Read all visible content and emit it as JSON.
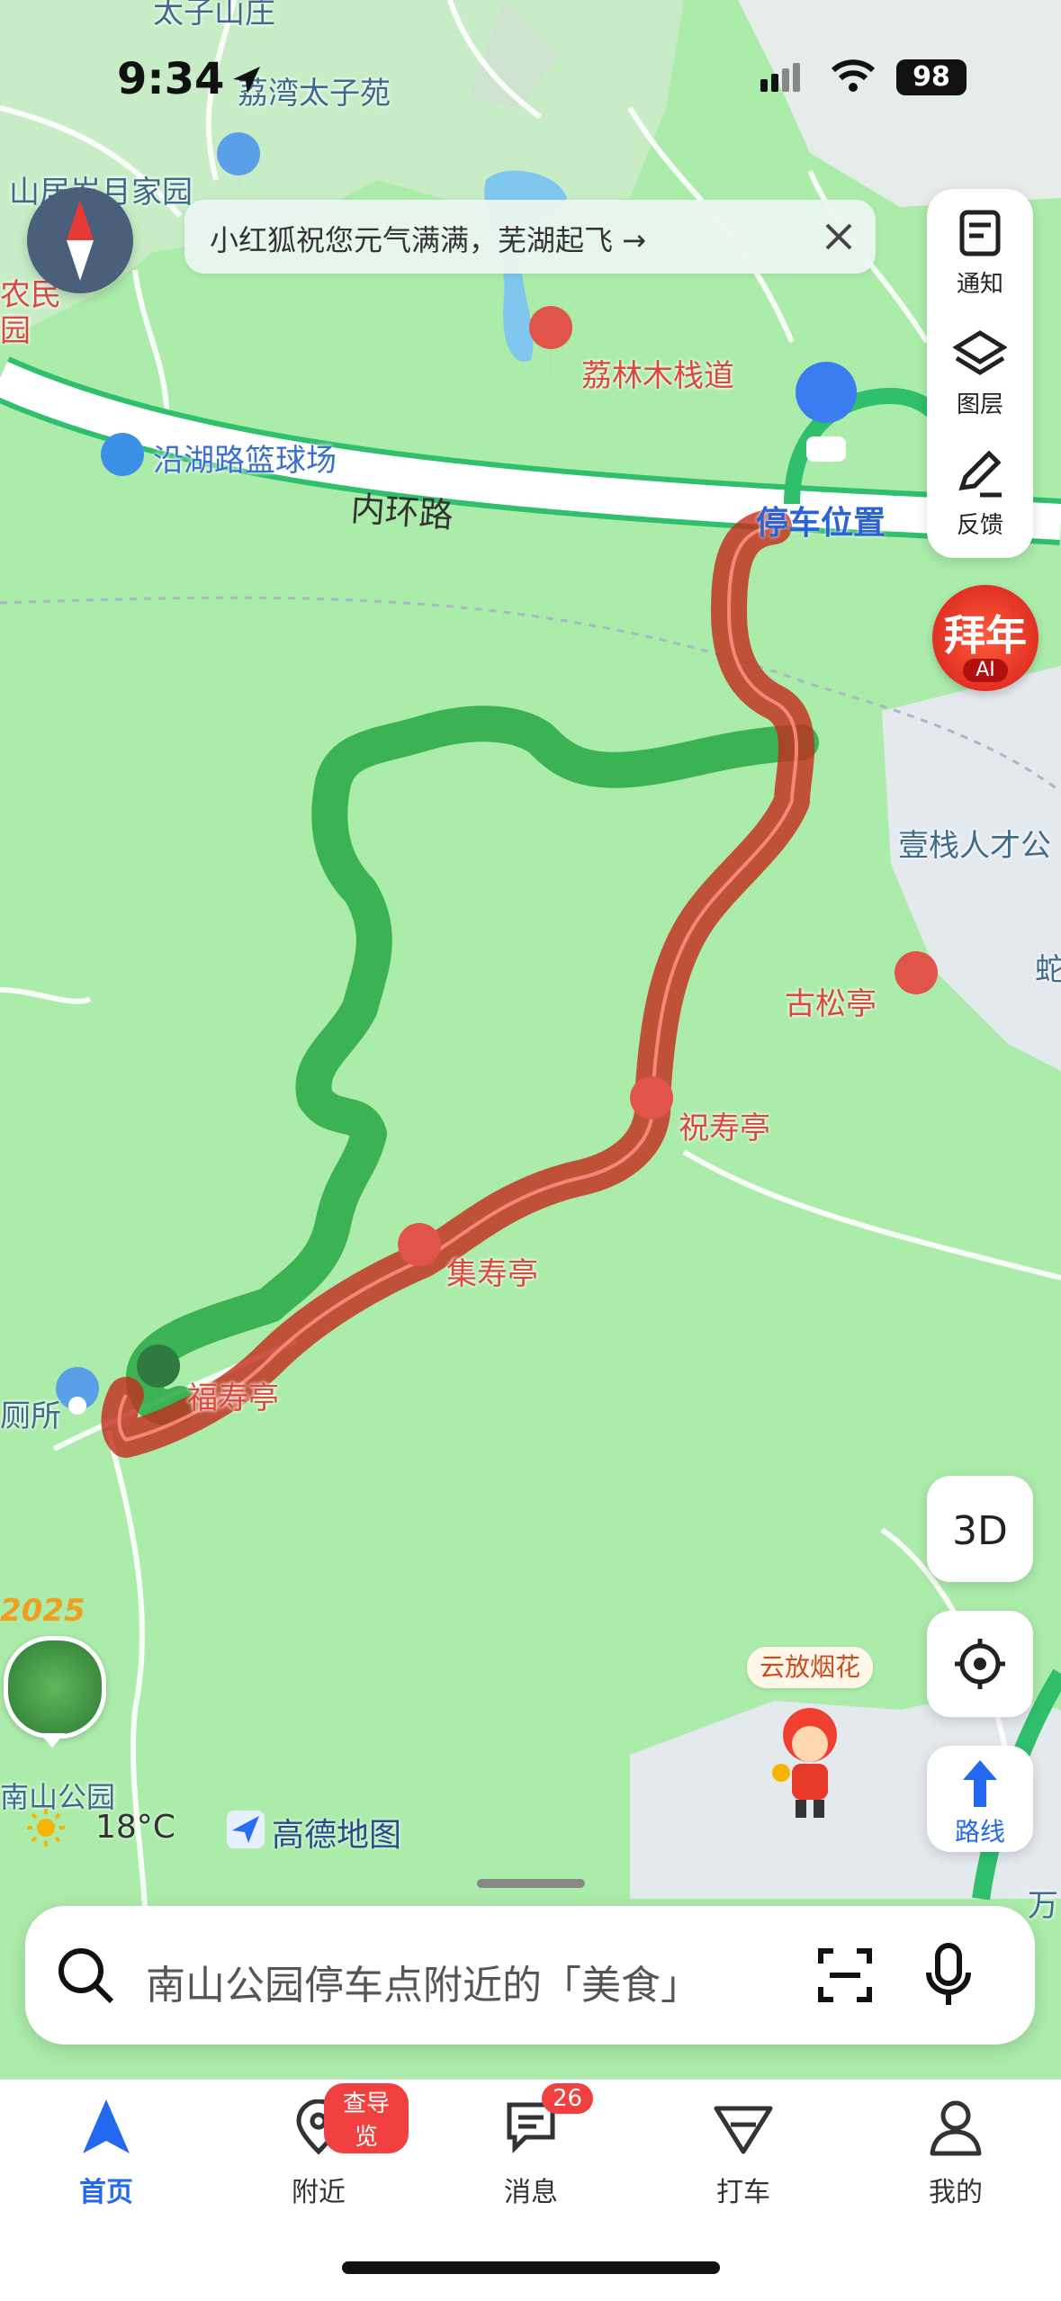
{
  "status_bar": {
    "time": "9:34",
    "battery": "98"
  },
  "banner": {
    "text": "小红狐祝您元气满满，芜湖起飞 →"
  },
  "side_panel": {
    "notify": "通知",
    "layers": "图层",
    "feedback": "反馈"
  },
  "promo": {
    "title": "拜年",
    "sub": "AI"
  },
  "map_labels": {
    "taizi_mountain": "太子山庄",
    "lijiang": "荔湾太子苑",
    "shanju": "山居岁月家园",
    "village": "农民",
    "village2": "园",
    "lilin": "荔林木栈道",
    "basketball": "沿湖路篮球场",
    "inner_ring": "内环路",
    "parking": "停车位置",
    "yizhan": "壹栈人才公",
    "gusong": "古松亭",
    "she": "蛇",
    "zhushou": "祝寿亭",
    "jishou": "集寿亭",
    "fushou": "福寿亭",
    "toilet": "厕所",
    "south_edge": "万",
    "road_edge": "南"
  },
  "place_card": {
    "name": "南山公园",
    "year": "2025"
  },
  "weather": {
    "temp": "18°C"
  },
  "brand": "高德地图",
  "fireworks": "云放烟花",
  "buttons": {
    "three_d": "3D",
    "route": "路线"
  },
  "search": {
    "placeholder": "南山公园停车点附近的「美食」"
  },
  "tabs": [
    {
      "label": "首页"
    },
    {
      "label": "附近",
      "badge": "查导览"
    },
    {
      "label": "消息",
      "badge": "26"
    },
    {
      "label": "打车"
    },
    {
      "label": "我的"
    }
  ],
  "colors": {
    "accent": "#2468f2",
    "route_green": "#28a745",
    "route_red": "#d63a2e",
    "map_green": "#acecab"
  }
}
